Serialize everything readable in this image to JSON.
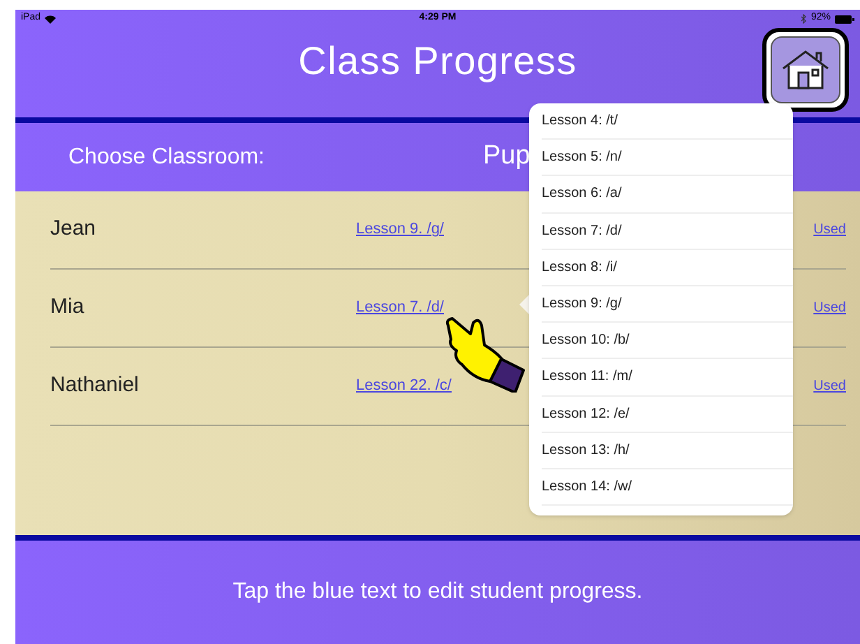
{
  "status_bar": {
    "device": "iPad",
    "time": "4:29 PM",
    "battery": "92%"
  },
  "title": "Class Progress",
  "classroom_bar": {
    "label": "Choose Classroom:",
    "value": "Pup"
  },
  "students": [
    {
      "name": "Jean",
      "lesson": "Lesson 9. /g/",
      "column_3": "Used"
    },
    {
      "name": "Mia",
      "lesson": "Lesson 7. /d/",
      "column_3": "Used"
    },
    {
      "name": "Nathaniel",
      "lesson": "Lesson 22. /c/",
      "column_3": "Used"
    }
  ],
  "dropdown": {
    "items": [
      {
        "label": "Lesson 4: /t/"
      },
      {
        "label": "Lesson 5: /n/"
      },
      {
        "label": "Lesson 6: /a/"
      },
      {
        "label": "Lesson 7: /d/"
      },
      {
        "label": "Lesson 8: /i/"
      },
      {
        "label": "Lesson 9: /g/"
      },
      {
        "label": "Lesson 10: /b/"
      },
      {
        "label": "Lesson 11: /m/"
      },
      {
        "label": "Lesson 12: /e/"
      },
      {
        "label": "Lesson 13: /h/"
      },
      {
        "label": "Lesson 14: /w/"
      }
    ]
  },
  "footer": "Tap the blue text to edit student progress."
}
